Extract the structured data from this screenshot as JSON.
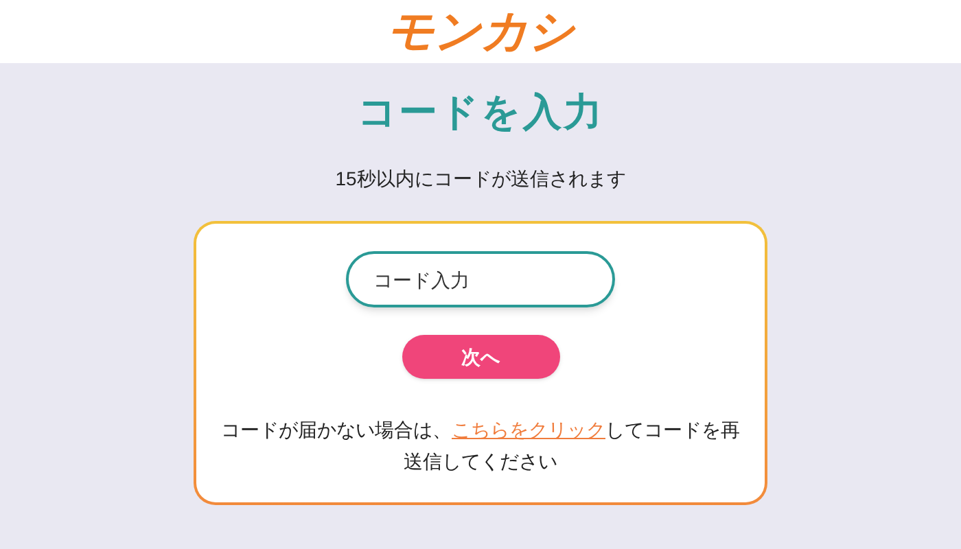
{
  "header": {
    "logo": "モンカシ"
  },
  "title": "コードを入力",
  "subtitle": "15秒以内にコードが送信されます",
  "code_field": {
    "placeholder": "コード入力"
  },
  "next_button": "次へ",
  "resend_note": {
    "before": "コードが届かない場合は、",
    "link": "こちらをクリック",
    "after": "してコードを再送信してください"
  }
}
